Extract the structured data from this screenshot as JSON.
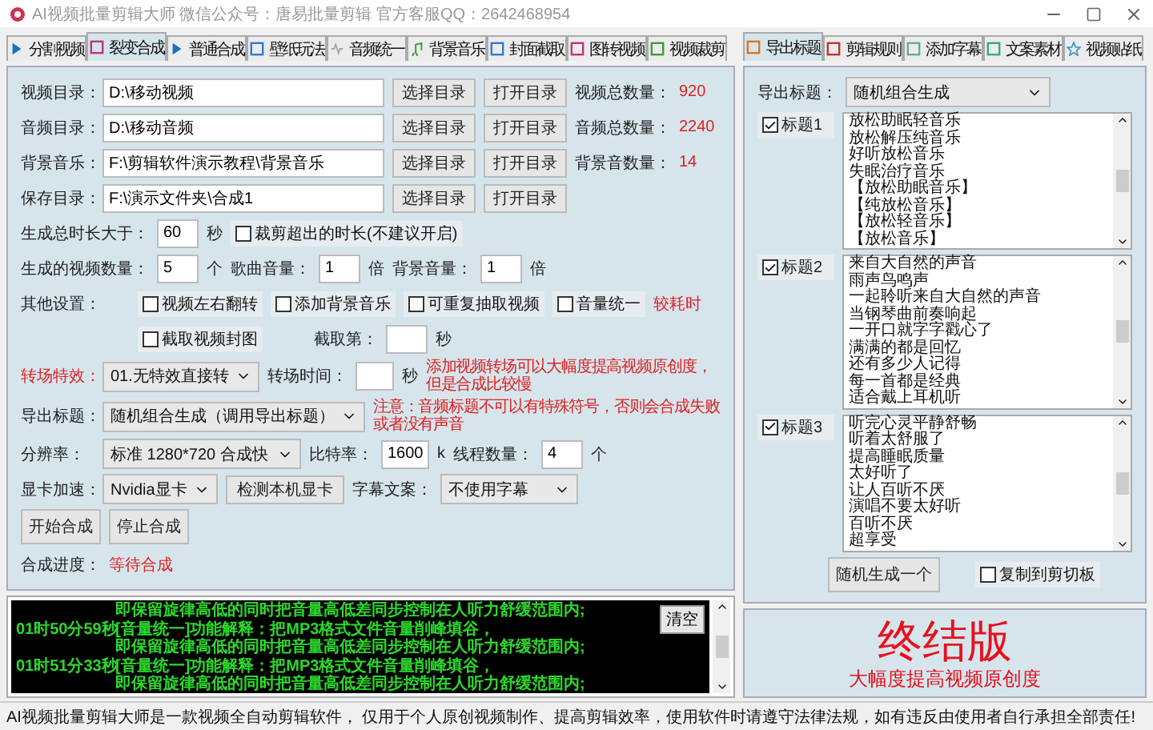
{
  "window": {
    "title": "AI视频批量剪辑大师  微信公众号：唐易批量剪辑  官方客服QQ：2642468954"
  },
  "left_tabs": [
    {
      "label": "分割视频",
      "selected": false
    },
    {
      "label": "裂变合成",
      "selected": true
    },
    {
      "label": "普通合成",
      "selected": false
    },
    {
      "label": "壁纸玩法",
      "selected": false
    },
    {
      "label": "音频统一",
      "selected": false
    },
    {
      "label": "背景音乐",
      "selected": false
    },
    {
      "label": "封面截取",
      "selected": false
    },
    {
      "label": "图转视频",
      "selected": false
    },
    {
      "label": "视频裁剪",
      "selected": false
    }
  ],
  "directories": [
    {
      "label": "视频目录：",
      "path": "D:\\移动视频",
      "buttons": [
        "选择目录",
        "打开目录"
      ],
      "count_label": "视频总数量：",
      "count": "920"
    },
    {
      "label": "音频目录：",
      "path": "D:\\移动音频",
      "buttons": [
        "选择目录",
        "打开目录"
      ],
      "count_label": "音频总数量：",
      "count": "2240"
    },
    {
      "label": "背景音乐：",
      "path": "F:\\剪辑软件演示教程\\背景音乐",
      "buttons": [
        "选择目录",
        "打开目录"
      ],
      "count_label": "背景音数量：",
      "count": "14"
    },
    {
      "label": "保存目录：",
      "path": "F:\\演示文件夹\\合成1",
      "buttons": [
        "选择目录",
        "打开目录"
      ]
    }
  ],
  "duration": {
    "label": "生成总时长大于：",
    "value": "60",
    "unit": "秒",
    "option": {
      "label": "裁剪超出的时长(不建议开启)",
      "checked": false
    }
  },
  "quantity": {
    "label": "生成的视频数量：",
    "value": "5",
    "unit": "个"
  },
  "song_volume": {
    "label": "歌曲音量：",
    "value": "1",
    "unit": "倍"
  },
  "background_volume": {
    "label": "背景音量：",
    "value": "1",
    "unit": "倍"
  },
  "other_settings": {
    "label": "其他设置：",
    "options": [
      {
        "label": "视频左右翻转",
        "checked": false
      },
      {
        "label": "添加背景音乐",
        "checked": false
      },
      {
        "label": "可重复抽取视频",
        "checked": false
      },
      {
        "label": "音量统一",
        "checked": false
      }
    ],
    "warning": "较耗时",
    "cover": {
      "label": "截取视频封图",
      "checked": false
    },
    "cover_time": {
      "label": "截取第：",
      "unit": "秒"
    }
  },
  "transition": {
    "label": "转场特效：",
    "value": "01.无特效直接转",
    "time_label": "转场时间：",
    "unit": "秒",
    "note": "添加视频转场可以大幅度提高视频原创度，但是合成比较慢"
  },
  "export_title": {
    "label": "导出标题：",
    "value": "随机组合生成（调用导出标题）",
    "note": "注意：音频标题不可以有特殊符号，否则会合成失败或者没有声音"
  },
  "resolution": {
    "label": "分辨率：",
    "value": "标准 1280*720 合成快",
    "bitrate_label": "比特率：",
    "bitrate": "1600",
    "bitrate_unit": "k",
    "threads_label": "线程数量：",
    "threads": "4",
    "threads_unit": "个"
  },
  "gpu": {
    "label": "显卡加速：",
    "value": "Nvidia显卡",
    "detect_button": "检测本机显卡",
    "subtitle_label": "字幕文案：",
    "subtitle_value": "不使用字幕"
  },
  "actions": [
    "开始合成",
    "停止合成"
  ],
  "progress": {
    "label": "合成进度：",
    "status": "等待合成"
  },
  "log": {
    "clear_button": "清空",
    "lines": [
      {
        "text": "即保留旋律高低的同时把音量高低差同步控制在人听力舒缓范围内;"
      },
      {
        "time": "01时50分59秒",
        "text": "[音量统一]功能解释：把MP3格式文件音量削峰填谷，"
      },
      {
        "text": "即保留旋律高低的同时把音量高低差同步控制在人听力舒缓范围内;"
      },
      {
        "time": "01时51分33秒",
        "text": "[音量统一]功能解释：把MP3格式文件音量削峰填谷，"
      },
      {
        "text": "即保留旋律高低的同时把音量高低差同步控制在人听力舒缓范围内;"
      }
    ]
  },
  "right_tabs": [
    {
      "label": "导出标题",
      "selected": true
    },
    {
      "label": "剪辑规则",
      "selected": false
    },
    {
      "label": "添加字幕",
      "selected": false
    },
    {
      "label": "文案素材",
      "selected": false
    },
    {
      "label": "视频贴纸",
      "selected": false
    }
  ],
  "title_source": {
    "label": "导出标题：",
    "value": "随机组合生成"
  },
  "title_lists": [
    {
      "label": "标题1",
      "checked": true,
      "lines": [
        "放松助眠轻音乐",
        "放松解压纯音乐",
        "好听放松音乐",
        "失眠治疗音乐",
        "【放松助眠音乐】",
        "【纯放松音乐】",
        "【放松轻音乐】",
        "【放松音乐】"
      ]
    },
    {
      "label": "标题2",
      "checked": true,
      "lines": [
        "来自大自然的声音",
        "雨声鸟鸣声",
        "一起聆听来自大自然的声音",
        "当钢琴曲前奏响起",
        "一开口就字字戳心了",
        "满满的都是回忆",
        "还有多少人记得",
        "每一首都是经典",
        "适合戴上耳机听"
      ]
    },
    {
      "label": "标题3",
      "checked": true,
      "lines": [
        "听完心灵平静舒畅",
        "听着太舒服了",
        "提高睡眠质量",
        "太好听了",
        "让人百听不厌",
        "演唱不要太好听",
        "百听不厌",
        "超享受"
      ]
    }
  ],
  "generate_button": "随机生成一个",
  "clipboard": {
    "label": "复制到剪切板",
    "checked": false
  },
  "promo": {
    "headline": "终结版",
    "subline": "大幅度提高视频原创度"
  },
  "status_bar": "AI视频批量剪辑大师是一款视频全自动剪辑软件， 仅用于个人原创视频制作、提高剪辑效率，使用软件时请遵守法律法规，如有违反由使用者自行承担全部责任!"
}
